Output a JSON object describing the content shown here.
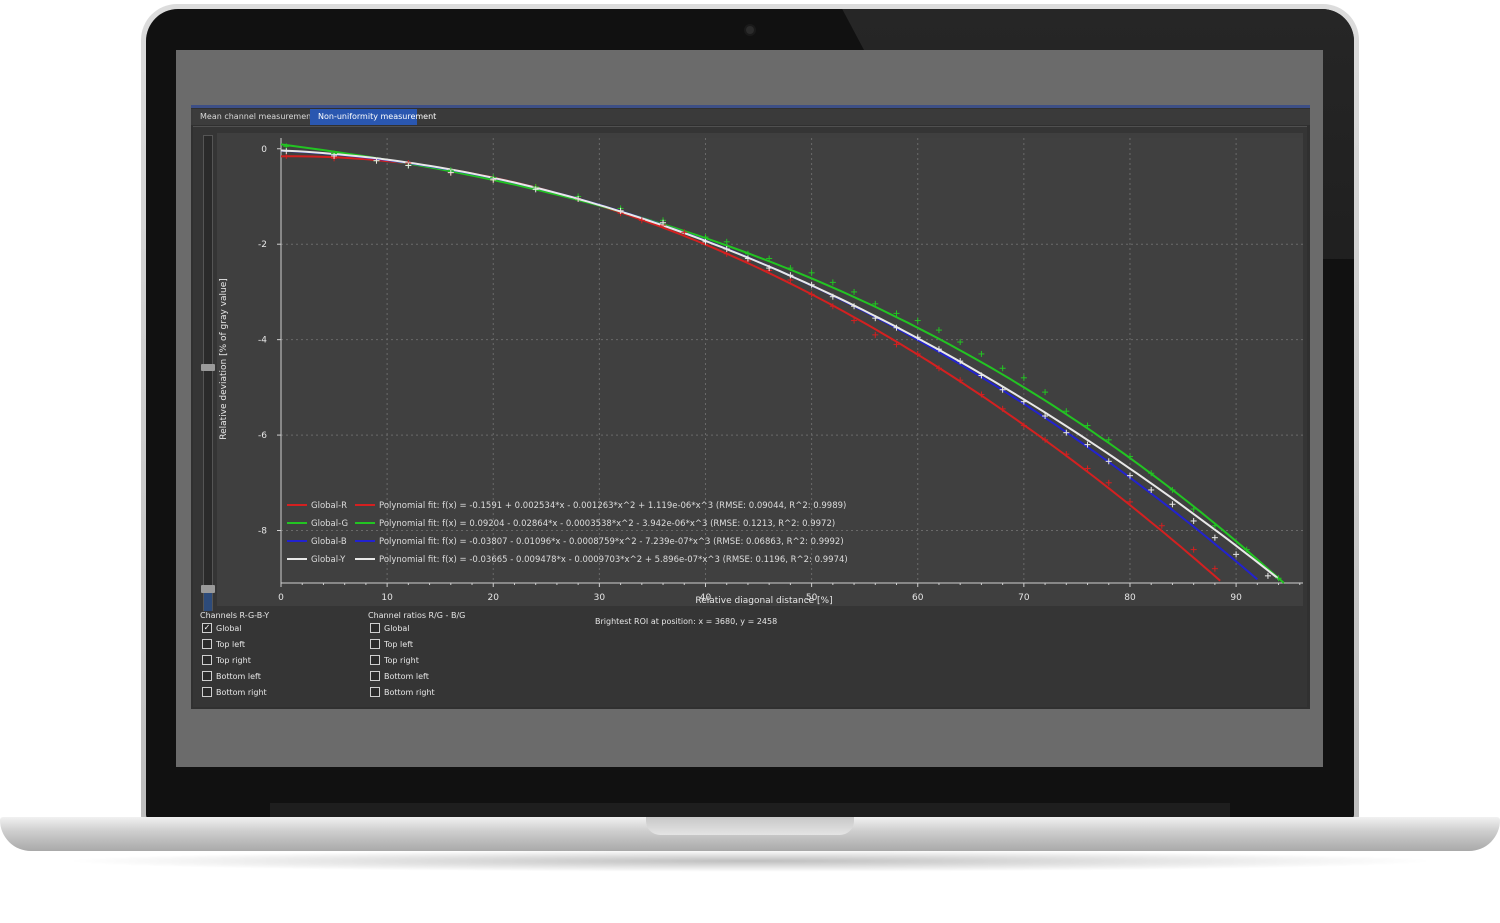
{
  "tabs": [
    {
      "label": "Mean channel measurement",
      "active": false
    },
    {
      "label": "Non-uniformity measurement",
      "active": true
    }
  ],
  "chart_data": {
    "type": "scatter",
    "xlabel": "Relative diagonal distance [%]",
    "ylabel": "Relative deviation [% of gray value]",
    "xlim": [
      0,
      98
    ],
    "ylim": [
      -9.1,
      0.1
    ],
    "xticks": [
      0,
      10,
      20,
      30,
      40,
      50,
      60,
      70,
      80,
      90
    ],
    "yticks": [
      0,
      -2,
      -4,
      -6,
      -8
    ],
    "grid": true,
    "legend_position": "bottom-left",
    "series": [
      {
        "name": "Global-R",
        "color": "#d42020",
        "fit_label": "Polynomial fit: f(x) = -0.1591 + 0.002534*x - 0.001263*x^2 + 1.119e-06*x^3 (RMSE: 0.09044, R^2: 0.9989)",
        "coeffs": [
          -0.1591,
          0.002534,
          -0.001263,
          1.119e-06
        ],
        "fit_range": [
          0,
          88.5
        ],
        "points": [
          [
            0.5,
            -0.15
          ],
          [
            5,
            -0.2
          ],
          [
            9,
            -0.25
          ],
          [
            12,
            -0.3
          ],
          [
            16,
            -0.5
          ],
          [
            20,
            -0.65
          ],
          [
            24,
            -0.8
          ],
          [
            28,
            -1.05
          ],
          [
            32,
            -1.35
          ],
          [
            34,
            -1.5
          ],
          [
            36,
            -1.6
          ],
          [
            38,
            -1.75
          ],
          [
            42,
            -2.2
          ],
          [
            44,
            -2.35
          ],
          [
            46,
            -2.55
          ],
          [
            48,
            -2.75
          ],
          [
            50,
            -3.05
          ],
          [
            52,
            -3.3
          ],
          [
            54,
            -3.6
          ],
          [
            56,
            -3.9
          ],
          [
            58,
            -4.1
          ],
          [
            60,
            -4.3
          ],
          [
            62,
            -4.6
          ],
          [
            64,
            -4.85
          ],
          [
            66,
            -5.15
          ],
          [
            68,
            -5.45
          ],
          [
            70,
            -5.8
          ],
          [
            72,
            -6.1
          ],
          [
            74,
            -6.4
          ],
          [
            76,
            -6.7
          ],
          [
            78,
            -7.0
          ],
          [
            80,
            -7.4
          ],
          [
            83,
            -7.9
          ],
          [
            86,
            -8.4
          ],
          [
            88,
            -8.8
          ]
        ]
      },
      {
        "name": "Global-G",
        "color": "#22c422",
        "fit_label": "Polynomial fit: f(x) = 0.09204 - 0.02864*x - 0.0003538*x^2 - 3.942e-06*x^3 (RMSE: 0.1213, R^2: 0.9972)",
        "coeffs": [
          0.09204,
          -0.02864,
          -0.0003538,
          -3.942e-06
        ],
        "fit_range": [
          0,
          94.5
        ],
        "points": [
          [
            0.5,
            0.05
          ],
          [
            5,
            -0.1
          ],
          [
            9,
            -0.25
          ],
          [
            12,
            -0.35
          ],
          [
            16,
            -0.45
          ],
          [
            20,
            -0.6
          ],
          [
            24,
            -0.8
          ],
          [
            28,
            -1.0
          ],
          [
            32,
            -1.25
          ],
          [
            36,
            -1.5
          ],
          [
            40,
            -1.85
          ],
          [
            42,
            -1.95
          ],
          [
            44,
            -2.2
          ],
          [
            46,
            -2.3
          ],
          [
            48,
            -2.5
          ],
          [
            50,
            -2.6
          ],
          [
            52,
            -2.8
          ],
          [
            54,
            -3.0
          ],
          [
            56,
            -3.25
          ],
          [
            58,
            -3.45
          ],
          [
            60,
            -3.6
          ],
          [
            62,
            -3.8
          ],
          [
            64,
            -4.05
          ],
          [
            66,
            -4.3
          ],
          [
            68,
            -4.6
          ],
          [
            70,
            -4.8
          ],
          [
            72,
            -5.1
          ],
          [
            74,
            -5.5
          ],
          [
            76,
            -5.8
          ],
          [
            78,
            -6.1
          ],
          [
            80,
            -6.45
          ],
          [
            82,
            -6.8
          ],
          [
            84,
            -7.15
          ],
          [
            86,
            -7.55
          ],
          [
            88,
            -7.9
          ],
          [
            91,
            -8.4
          ],
          [
            94,
            -9.0
          ]
        ]
      },
      {
        "name": "Global-B",
        "color": "#2222d0",
        "fit_label": "Polynomial fit: f(x) = -0.03807 - 0.01096*x - 0.0008759*x^2 - 7.239e-07*x^3 (RMSE: 0.06863, R^2: 0.9992)",
        "coeffs": [
          -0.03807,
          -0.01096,
          -0.0008759,
          -7.239e-07
        ],
        "fit_range": [
          0,
          92
        ]
      },
      {
        "name": "Global-Y",
        "color": "#e8e8e8",
        "fit_label": "Polynomial fit: f(x) = -0.03665 - 0.009478*x - 0.0009703*x^2 + 5.896e-07*x^3 (RMSE: 0.1196, R^2: 0.9974)",
        "coeffs": [
          -0.03665,
          -0.009478,
          -0.0009703,
          5.896e-07
        ],
        "fit_range": [
          0,
          94
        ],
        "points": [
          [
            0.5,
            -0.05
          ],
          [
            5,
            -0.15
          ],
          [
            9,
            -0.25
          ],
          [
            12,
            -0.35
          ],
          [
            16,
            -0.5
          ],
          [
            20,
            -0.65
          ],
          [
            24,
            -0.85
          ],
          [
            28,
            -1.05
          ],
          [
            32,
            -1.3
          ],
          [
            36,
            -1.55
          ],
          [
            40,
            -1.95
          ],
          [
            42,
            -2.1
          ],
          [
            44,
            -2.3
          ],
          [
            46,
            -2.5
          ],
          [
            48,
            -2.65
          ],
          [
            50,
            -2.85
          ],
          [
            52,
            -3.1
          ],
          [
            54,
            -3.3
          ],
          [
            56,
            -3.55
          ],
          [
            58,
            -3.75
          ],
          [
            60,
            -3.95
          ],
          [
            62,
            -4.2
          ],
          [
            64,
            -4.45
          ],
          [
            66,
            -4.75
          ],
          [
            68,
            -5.05
          ],
          [
            70,
            -5.3
          ],
          [
            72,
            -5.6
          ],
          [
            74,
            -5.95
          ],
          [
            76,
            -6.2
          ],
          [
            78,
            -6.55
          ],
          [
            80,
            -6.85
          ],
          [
            82,
            -7.15
          ],
          [
            84,
            -7.45
          ],
          [
            86,
            -7.8
          ],
          [
            88,
            -8.15
          ],
          [
            90,
            -8.5
          ],
          [
            93,
            -8.95
          ]
        ]
      }
    ]
  },
  "controls": {
    "channels": {
      "title": "Channels R-G-B-Y",
      "items": [
        {
          "label": "Global",
          "checked": true
        },
        {
          "label": "Top left",
          "checked": false
        },
        {
          "label": "Top right",
          "checked": false
        },
        {
          "label": "Bottom left",
          "checked": false
        },
        {
          "label": "Bottom right",
          "checked": false
        }
      ]
    },
    "ratios": {
      "title": "Channel ratios R/G - B/G",
      "items": [
        {
          "label": "Global",
          "checked": false
        },
        {
          "label": "Top left",
          "checked": false
        },
        {
          "label": "Top right",
          "checked": false
        },
        {
          "label": "Bottom left",
          "checked": false
        },
        {
          "label": "Bottom right",
          "checked": false
        }
      ]
    },
    "status": "Brightest ROI at position: x = 3680, y = 2458"
  },
  "icons": {
    "checkmark": "check-icon",
    "camera": "camera-icon"
  }
}
